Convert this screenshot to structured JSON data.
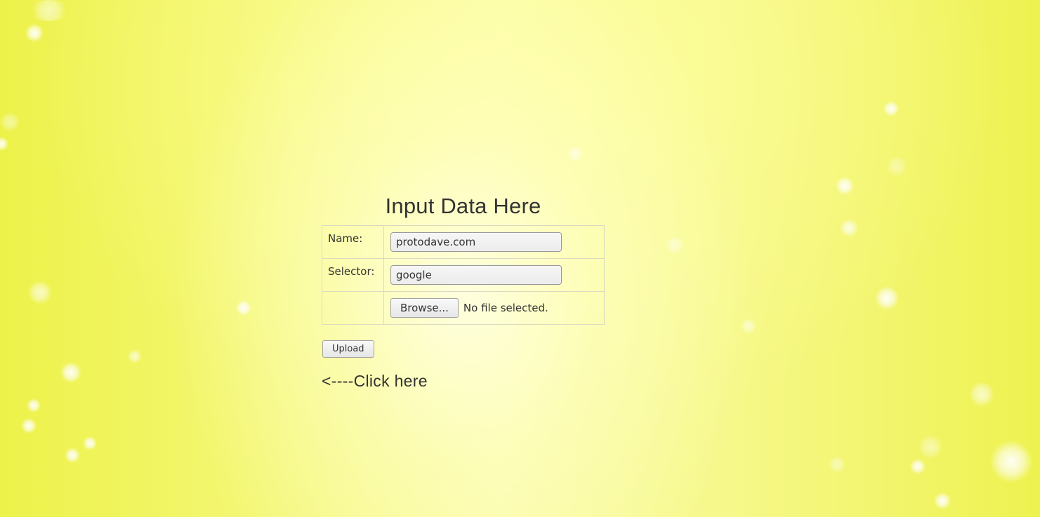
{
  "form": {
    "title": "Input Data Here",
    "name_label": "Name:",
    "name_value": "protodave.com",
    "selector_label": "Selector:",
    "selector_value": "google",
    "browse_label": "Browse...",
    "file_status": "No file selected.",
    "upload_label": "Upload",
    "hint_text": "<----Click here"
  },
  "colors": {
    "background_edge": "#edf24a",
    "background_center": "#fafca8",
    "text": "#333333"
  }
}
